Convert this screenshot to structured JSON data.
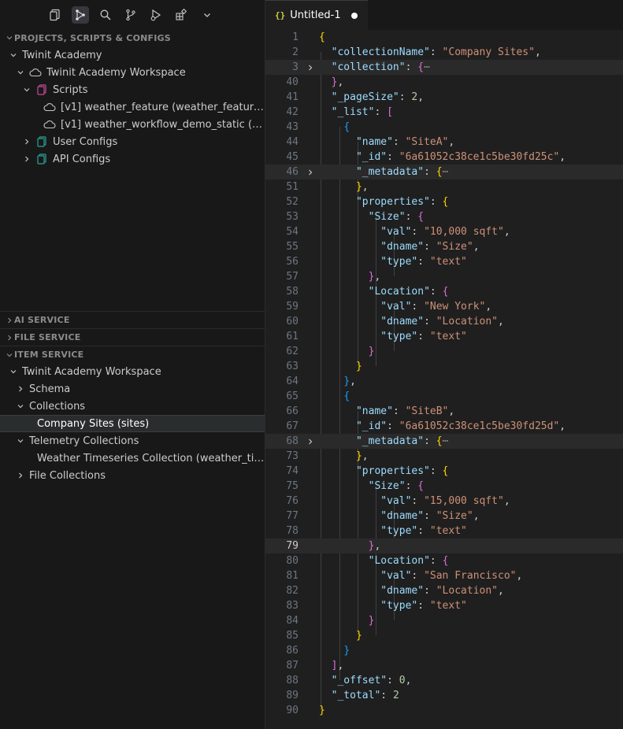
{
  "toolbar": {
    "icons": [
      "copy-icon",
      "source-graph-icon",
      "search-icon",
      "source-control-icon",
      "run-debug-icon",
      "extensions-icon",
      "chevron-down-icon"
    ]
  },
  "sidebar": {
    "projects_header": "PROJECTS, SCRIPTS & CONFIGS",
    "projects_tree": [
      {
        "label": "Twinit Academy"
      },
      {
        "label": "Twinit Academy Workspace"
      },
      {
        "label": "Scripts"
      },
      {
        "label": "[v1] weather_feature (weather_feature) <..."
      },
      {
        "label": "[v1] weather_workflow_demo_static (weat..."
      },
      {
        "label": "User Configs"
      },
      {
        "label": "API Configs"
      }
    ],
    "ai_service_header": "AI SERVICE",
    "file_service_header": "FILE SERVICE",
    "item_service_header": "ITEM SERVICE",
    "item_tree": [
      {
        "label": "Twinit Academy Workspace"
      },
      {
        "label": "Schema"
      },
      {
        "label": "Collections"
      },
      {
        "label": "Company Sites (sites)"
      },
      {
        "label": "Telemetry Collections"
      },
      {
        "label": "Weather Timeseries Collection (weather_times..."
      },
      {
        "label": "File Collections"
      }
    ]
  },
  "tab": {
    "icon_text": "{}",
    "title": "Untitled-1"
  },
  "editor": {
    "lines": [
      {
        "n": "1",
        "fold": false,
        "hl": false,
        "cur": false,
        "tokens": [
          [
            "b1",
            "{"
          ]
        ]
      },
      {
        "n": "2",
        "fold": false,
        "hl": false,
        "cur": false,
        "tokens": [
          [
            "p",
            "  "
          ],
          [
            "k",
            "\"collectionName\""
          ],
          [
            "p",
            ": "
          ],
          [
            "s",
            "\"Company Sites\""
          ],
          [
            "p",
            ","
          ]
        ]
      },
      {
        "n": "3",
        "fold": true,
        "hl": true,
        "cur": false,
        "tokens": [
          [
            "p",
            "  "
          ],
          [
            "k",
            "\"collection\""
          ],
          [
            "p",
            ": "
          ],
          [
            "b2",
            "{"
          ],
          [
            "ell",
            "⋯"
          ]
        ]
      },
      {
        "n": "40",
        "fold": false,
        "hl": false,
        "cur": false,
        "tokens": [
          [
            "p",
            "  "
          ],
          [
            "b2",
            "}"
          ],
          [
            "p",
            ","
          ]
        ]
      },
      {
        "n": "41",
        "fold": false,
        "hl": false,
        "cur": false,
        "tokens": [
          [
            "p",
            "  "
          ],
          [
            "k",
            "\"_pageSize\""
          ],
          [
            "p",
            ": "
          ],
          [
            "n",
            "2"
          ],
          [
            "p",
            ","
          ]
        ]
      },
      {
        "n": "42",
        "fold": false,
        "hl": false,
        "cur": false,
        "tokens": [
          [
            "p",
            "  "
          ],
          [
            "k",
            "\"_list\""
          ],
          [
            "p",
            ": "
          ],
          [
            "b2",
            "["
          ]
        ]
      },
      {
        "n": "43",
        "fold": false,
        "hl": false,
        "cur": false,
        "tokens": [
          [
            "p",
            "    "
          ],
          [
            "b3",
            "{"
          ]
        ]
      },
      {
        "n": "44",
        "fold": false,
        "hl": false,
        "cur": false,
        "tokens": [
          [
            "p",
            "      "
          ],
          [
            "k",
            "\"name\""
          ],
          [
            "p",
            ": "
          ],
          [
            "s",
            "\"SiteA\""
          ],
          [
            "p",
            ","
          ]
        ]
      },
      {
        "n": "45",
        "fold": false,
        "hl": false,
        "cur": false,
        "tokens": [
          [
            "p",
            "      "
          ],
          [
            "k",
            "\"_id\""
          ],
          [
            "p",
            ": "
          ],
          [
            "s",
            "\"6a61052c38ce1c5be30fd25c\""
          ],
          [
            "p",
            ","
          ]
        ]
      },
      {
        "n": "46",
        "fold": true,
        "hl": true,
        "cur": false,
        "tokens": [
          [
            "p",
            "      "
          ],
          [
            "k",
            "\"_metadata\""
          ],
          [
            "p",
            ": "
          ],
          [
            "b1",
            "{"
          ],
          [
            "ell",
            "⋯"
          ]
        ]
      },
      {
        "n": "51",
        "fold": false,
        "hl": false,
        "cur": false,
        "tokens": [
          [
            "p",
            "      "
          ],
          [
            "b1",
            "}"
          ],
          [
            "p",
            ","
          ]
        ]
      },
      {
        "n": "52",
        "fold": false,
        "hl": false,
        "cur": false,
        "tokens": [
          [
            "p",
            "      "
          ],
          [
            "k",
            "\"properties\""
          ],
          [
            "p",
            ": "
          ],
          [
            "b1",
            "{"
          ]
        ]
      },
      {
        "n": "53",
        "fold": false,
        "hl": false,
        "cur": false,
        "tokens": [
          [
            "p",
            "        "
          ],
          [
            "k",
            "\"Size\""
          ],
          [
            "p",
            ": "
          ],
          [
            "b2",
            "{"
          ]
        ]
      },
      {
        "n": "54",
        "fold": false,
        "hl": false,
        "cur": false,
        "tokens": [
          [
            "p",
            "          "
          ],
          [
            "k",
            "\"val\""
          ],
          [
            "p",
            ": "
          ],
          [
            "s",
            "\"10,000 sqft\""
          ],
          [
            "p",
            ","
          ]
        ]
      },
      {
        "n": "55",
        "fold": false,
        "hl": false,
        "cur": false,
        "tokens": [
          [
            "p",
            "          "
          ],
          [
            "k",
            "\"dname\""
          ],
          [
            "p",
            ": "
          ],
          [
            "s",
            "\"Size\""
          ],
          [
            "p",
            ","
          ]
        ]
      },
      {
        "n": "56",
        "fold": false,
        "hl": false,
        "cur": false,
        "tokens": [
          [
            "p",
            "          "
          ],
          [
            "k",
            "\"type\""
          ],
          [
            "p",
            ": "
          ],
          [
            "s",
            "\"text\""
          ]
        ]
      },
      {
        "n": "57",
        "fold": false,
        "hl": false,
        "cur": false,
        "tokens": [
          [
            "p",
            "        "
          ],
          [
            "b2",
            "}"
          ],
          [
            "p",
            ","
          ]
        ]
      },
      {
        "n": "58",
        "fold": false,
        "hl": false,
        "cur": false,
        "tokens": [
          [
            "p",
            "        "
          ],
          [
            "k",
            "\"Location\""
          ],
          [
            "p",
            ": "
          ],
          [
            "b2",
            "{"
          ]
        ]
      },
      {
        "n": "59",
        "fold": false,
        "hl": false,
        "cur": false,
        "tokens": [
          [
            "p",
            "          "
          ],
          [
            "k",
            "\"val\""
          ],
          [
            "p",
            ": "
          ],
          [
            "s",
            "\"New York\""
          ],
          [
            "p",
            ","
          ]
        ]
      },
      {
        "n": "60",
        "fold": false,
        "hl": false,
        "cur": false,
        "tokens": [
          [
            "p",
            "          "
          ],
          [
            "k",
            "\"dname\""
          ],
          [
            "p",
            ": "
          ],
          [
            "s",
            "\"Location\""
          ],
          [
            "p",
            ","
          ]
        ]
      },
      {
        "n": "61",
        "fold": false,
        "hl": false,
        "cur": false,
        "tokens": [
          [
            "p",
            "          "
          ],
          [
            "k",
            "\"type\""
          ],
          [
            "p",
            ": "
          ],
          [
            "s",
            "\"text\""
          ]
        ]
      },
      {
        "n": "62",
        "fold": false,
        "hl": false,
        "cur": false,
        "tokens": [
          [
            "p",
            "        "
          ],
          [
            "b2",
            "}"
          ]
        ]
      },
      {
        "n": "63",
        "fold": false,
        "hl": false,
        "cur": false,
        "tokens": [
          [
            "p",
            "      "
          ],
          [
            "b1",
            "}"
          ]
        ]
      },
      {
        "n": "64",
        "fold": false,
        "hl": false,
        "cur": false,
        "tokens": [
          [
            "p",
            "    "
          ],
          [
            "b3",
            "}"
          ],
          [
            "p",
            ","
          ]
        ]
      },
      {
        "n": "65",
        "fold": false,
        "hl": false,
        "cur": false,
        "tokens": [
          [
            "p",
            "    "
          ],
          [
            "b3",
            "{"
          ]
        ]
      },
      {
        "n": "66",
        "fold": false,
        "hl": false,
        "cur": false,
        "tokens": [
          [
            "p",
            "      "
          ],
          [
            "k",
            "\"name\""
          ],
          [
            "p",
            ": "
          ],
          [
            "s",
            "\"SiteB\""
          ],
          [
            "p",
            ","
          ]
        ]
      },
      {
        "n": "67",
        "fold": false,
        "hl": false,
        "cur": false,
        "tokens": [
          [
            "p",
            "      "
          ],
          [
            "k",
            "\"_id\""
          ],
          [
            "p",
            ": "
          ],
          [
            "s",
            "\"6a61052c38ce1c5be30fd25d\""
          ],
          [
            "p",
            ","
          ]
        ]
      },
      {
        "n": "68",
        "fold": true,
        "hl": true,
        "cur": false,
        "tokens": [
          [
            "p",
            "      "
          ],
          [
            "k",
            "\"_metadata\""
          ],
          [
            "p",
            ": "
          ],
          [
            "b1",
            "{"
          ],
          [
            "ell",
            "⋯"
          ]
        ]
      },
      {
        "n": "73",
        "fold": false,
        "hl": false,
        "cur": false,
        "tokens": [
          [
            "p",
            "      "
          ],
          [
            "b1",
            "}"
          ],
          [
            "p",
            ","
          ]
        ]
      },
      {
        "n": "74",
        "fold": false,
        "hl": false,
        "cur": false,
        "tokens": [
          [
            "p",
            "      "
          ],
          [
            "k",
            "\"properties\""
          ],
          [
            "p",
            ": "
          ],
          [
            "b1",
            "{"
          ]
        ]
      },
      {
        "n": "75",
        "fold": false,
        "hl": false,
        "cur": false,
        "tokens": [
          [
            "p",
            "        "
          ],
          [
            "k",
            "\"Size\""
          ],
          [
            "p",
            ": "
          ],
          [
            "b2",
            "{"
          ]
        ]
      },
      {
        "n": "76",
        "fold": false,
        "hl": false,
        "cur": false,
        "tokens": [
          [
            "p",
            "          "
          ],
          [
            "k",
            "\"val\""
          ],
          [
            "p",
            ": "
          ],
          [
            "s",
            "\"15,000 sqft\""
          ],
          [
            "p",
            ","
          ]
        ]
      },
      {
        "n": "77",
        "fold": false,
        "hl": false,
        "cur": false,
        "tokens": [
          [
            "p",
            "          "
          ],
          [
            "k",
            "\"dname\""
          ],
          [
            "p",
            ": "
          ],
          [
            "s",
            "\"Size\""
          ],
          [
            "p",
            ","
          ]
        ]
      },
      {
        "n": "78",
        "fold": false,
        "hl": false,
        "cur": false,
        "tokens": [
          [
            "p",
            "          "
          ],
          [
            "k",
            "\"type\""
          ],
          [
            "p",
            ": "
          ],
          [
            "s",
            "\"text\""
          ]
        ]
      },
      {
        "n": "79",
        "fold": false,
        "hl": true,
        "cur": true,
        "tokens": [
          [
            "p",
            "        "
          ],
          [
            "b2",
            "}"
          ],
          [
            "p",
            ","
          ]
        ]
      },
      {
        "n": "80",
        "fold": false,
        "hl": false,
        "cur": false,
        "tokens": [
          [
            "p",
            "        "
          ],
          [
            "k",
            "\"Location\""
          ],
          [
            "p",
            ": "
          ],
          [
            "b2",
            "{"
          ]
        ]
      },
      {
        "n": "81",
        "fold": false,
        "hl": false,
        "cur": false,
        "tokens": [
          [
            "p",
            "          "
          ],
          [
            "k",
            "\"val\""
          ],
          [
            "p",
            ": "
          ],
          [
            "s",
            "\"San Francisco\""
          ],
          [
            "p",
            ","
          ]
        ]
      },
      {
        "n": "82",
        "fold": false,
        "hl": false,
        "cur": false,
        "tokens": [
          [
            "p",
            "          "
          ],
          [
            "k",
            "\"dname\""
          ],
          [
            "p",
            ": "
          ],
          [
            "s",
            "\"Location\""
          ],
          [
            "p",
            ","
          ]
        ]
      },
      {
        "n": "83",
        "fold": false,
        "hl": false,
        "cur": false,
        "tokens": [
          [
            "p",
            "          "
          ],
          [
            "k",
            "\"type\""
          ],
          [
            "p",
            ": "
          ],
          [
            "s",
            "\"text\""
          ]
        ]
      },
      {
        "n": "84",
        "fold": false,
        "hl": false,
        "cur": false,
        "tokens": [
          [
            "p",
            "        "
          ],
          [
            "b2",
            "}"
          ]
        ]
      },
      {
        "n": "85",
        "fold": false,
        "hl": false,
        "cur": false,
        "tokens": [
          [
            "p",
            "      "
          ],
          [
            "b1",
            "}"
          ]
        ]
      },
      {
        "n": "86",
        "fold": false,
        "hl": false,
        "cur": false,
        "tokens": [
          [
            "p",
            "    "
          ],
          [
            "b3",
            "}"
          ]
        ]
      },
      {
        "n": "87",
        "fold": false,
        "hl": false,
        "cur": false,
        "tokens": [
          [
            "p",
            "  "
          ],
          [
            "b2",
            "]"
          ],
          [
            "p",
            ","
          ]
        ]
      },
      {
        "n": "88",
        "fold": false,
        "hl": false,
        "cur": false,
        "tokens": [
          [
            "p",
            "  "
          ],
          [
            "k",
            "\"_offset\""
          ],
          [
            "p",
            ": "
          ],
          [
            "n",
            "0"
          ],
          [
            "p",
            ","
          ]
        ]
      },
      {
        "n": "89",
        "fold": false,
        "hl": false,
        "cur": false,
        "tokens": [
          [
            "p",
            "  "
          ],
          [
            "k",
            "\"_total\""
          ],
          [
            "p",
            ": "
          ],
          [
            "n",
            "2"
          ]
        ]
      },
      {
        "n": "90",
        "fold": false,
        "hl": false,
        "cur": false,
        "tokens": [
          [
            "b1",
            "}"
          ]
        ]
      }
    ]
  }
}
